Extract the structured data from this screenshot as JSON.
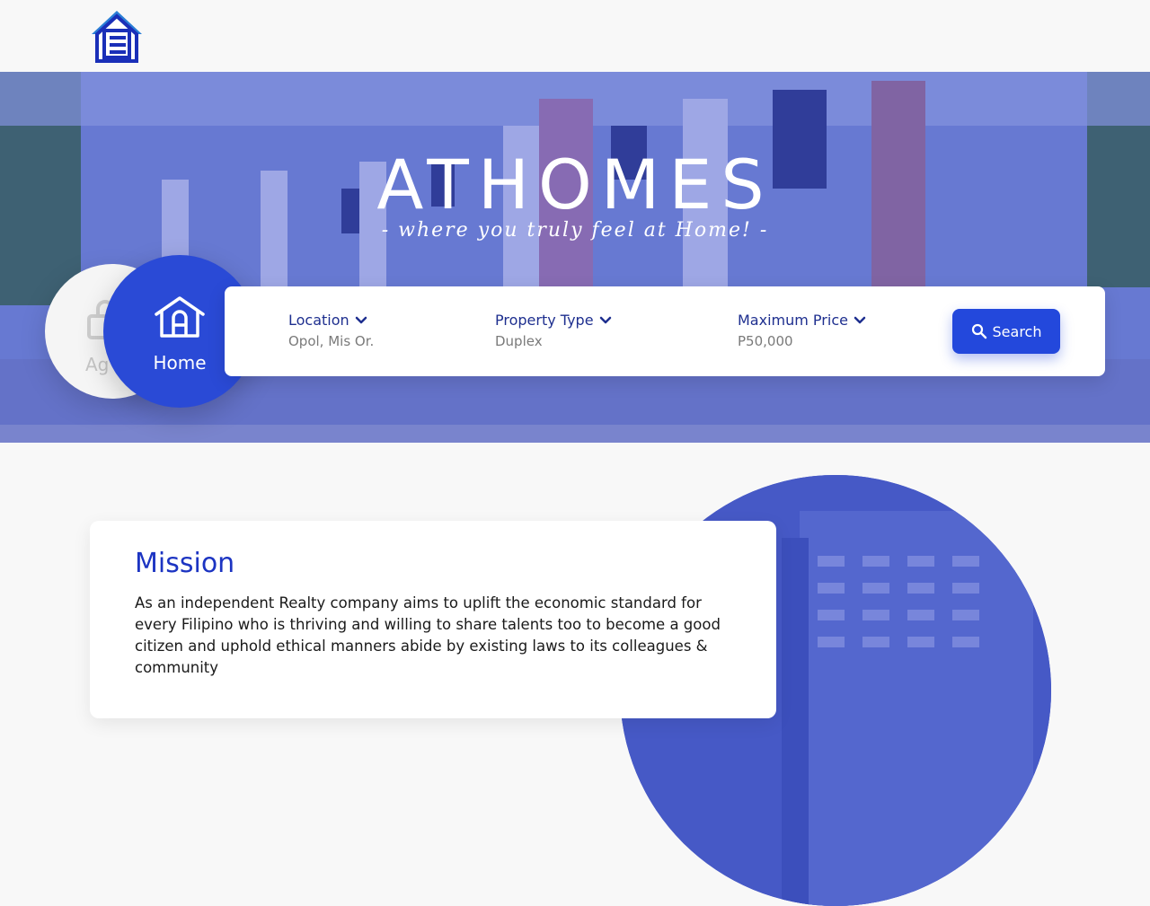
{
  "header": {
    "logo_icon": "house-logo-icon"
  },
  "hero": {
    "title": "ATHOMES",
    "tagline": "- where you truly feel at Home! -"
  },
  "categories": {
    "agent_label": "Ag",
    "home_label": "Home",
    "agent_icon": "agent-icon",
    "home_icon": "home-icon"
  },
  "search": {
    "location_label": "Location",
    "location_value": "Opol, Mis Or.",
    "type_label": "Property Type",
    "type_value": "Duplex",
    "price_label": "Maximum Price",
    "price_value": "P50,000",
    "button_label": "Search",
    "search_icon": "search-icon",
    "chevron_icon": "chevron-down-icon"
  },
  "mission": {
    "title": "Mission",
    "text": "As an independent Realty company aims to uplift the economic standard for every Filipino who is thriving and willing to share talents too to become a good citizen and uphold ethical manners abide by existing laws to its colleagues & community"
  },
  "colors": {
    "primary": "#2348dc",
    "title_blue": "#1c34c2",
    "label_navy": "#1e2f8f"
  }
}
